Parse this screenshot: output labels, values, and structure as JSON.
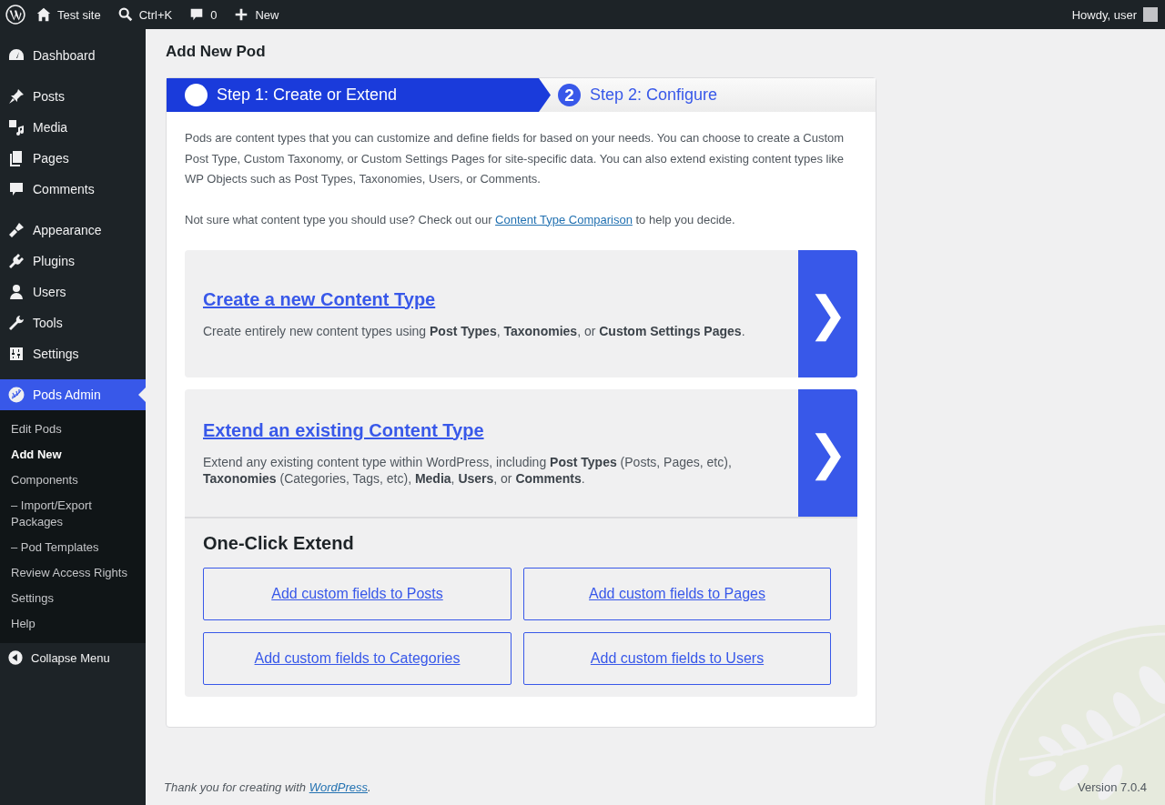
{
  "admin_bar": {
    "items": [
      {
        "kind": "home",
        "label": "Test site"
      },
      {
        "kind": "search",
        "label": "Ctrl+K"
      },
      {
        "kind": "comments",
        "label": "0"
      },
      {
        "kind": "new",
        "label": "New"
      }
    ],
    "greeting": "Howdy, user"
  },
  "sidebar": {
    "groups": [
      [
        {
          "kind": "dashboard",
          "label": "Dashboard",
          "selected": false
        }
      ],
      [
        {
          "kind": "posts",
          "label": "Posts",
          "selected": false
        },
        {
          "kind": "media",
          "label": "Media",
          "selected": false
        },
        {
          "kind": "pages",
          "label": "Pages",
          "selected": false
        },
        {
          "kind": "comments",
          "label": "Comments",
          "selected": false
        }
      ],
      [
        {
          "kind": "appearance",
          "label": "Appearance",
          "selected": false
        },
        {
          "kind": "plugins",
          "label": "Plugins",
          "selected": false
        },
        {
          "kind": "users",
          "label": "Users",
          "selected": false
        },
        {
          "kind": "tools",
          "label": "Tools",
          "selected": false
        },
        {
          "kind": "settings",
          "label": "Settings",
          "selected": false
        }
      ],
      [
        {
          "kind": "pods",
          "label": "Pods Admin",
          "selected": true,
          "children": [
            {
              "label": "Edit Pods",
              "selected": false
            },
            {
              "label": "Add New",
              "selected": true
            },
            {
              "label": "Components",
              "selected": false
            },
            {
              "label": "– Import/Export Packages",
              "selected": false
            },
            {
              "label": "– Pod Templates",
              "selected": false
            },
            {
              "label": "Review Access Rights",
              "selected": false
            },
            {
              "label": "Settings",
              "selected": false
            },
            {
              "label": "Help",
              "selected": false
            }
          ]
        }
      ]
    ],
    "collapse": "Collapse Menu"
  },
  "page_title": "Add New Pod",
  "steps": [
    {
      "label": "Step 1: Create or Extend",
      "selected": true
    },
    {
      "number": "2",
      "label": "Step 2: Configure",
      "selected": false
    }
  ],
  "intro": [
    {
      "text": "Pods are content types that you can customize and define fields for based on your needs. You can choose to create a Custom Post Type, Custom Taxonomy, or Custom Settings Pages for site-specific data. You can also extend existing content types like WP Objects such as Post Types, Taxonomies, Users, or Comments."
    },
    {
      "text": "Not sure what content type you should use? Check out our ",
      "link": "Content Type Comparison",
      "after": " to help you decide."
    }
  ],
  "options": [
    {
      "title": "Create a new Content Type",
      "description": "Create entirely new content types using **Post Types**, **Taxonomies**, or **Custom Settings Pages**.",
      "arrow": "❯"
    },
    {
      "title": "Extend an existing Content Type",
      "description": "Extend any existing content type within WordPress, including **Post Types** (Posts, Pages, etc), **Taxonomies** (Categories, Tags, etc), **Media**, **Users**, or **Comments**.",
      "arrow": "❯",
      "one_click": {
        "title": "One-Click Extend",
        "buttons": [
          "Add custom fields to Posts",
          "Add custom fields to Pages",
          "Add custom fields to Categories",
          "Add custom fields to Users"
        ]
      }
    }
  ],
  "footer": {
    "text": "Thank you for creating with ",
    "link": "WordPress",
    "after": ".",
    "version": "Version 7.0.4"
  }
}
